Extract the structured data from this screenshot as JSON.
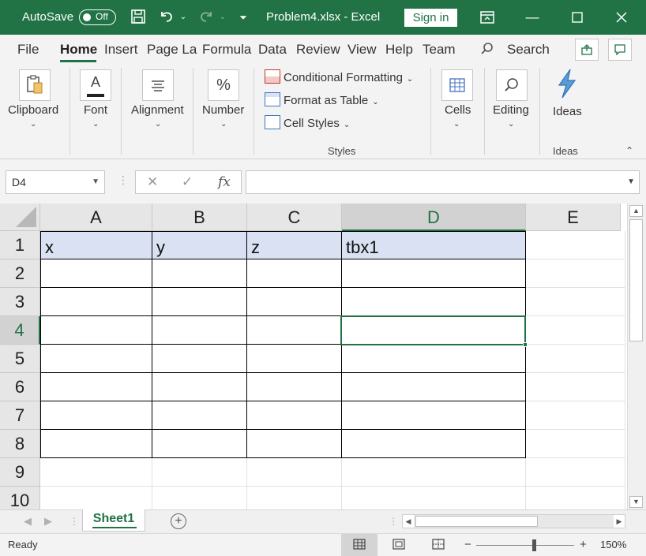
{
  "titlebar": {
    "autosave_label": "AutoSave",
    "autosave_state": "Off",
    "filename": "Problem4.xlsx",
    "separator": "-",
    "app_name": "Excel",
    "signin_label": "Sign in",
    "accent_color": "#217346"
  },
  "tabs": [
    "File",
    "Home",
    "Insert",
    "Page La",
    "Formula",
    "Data",
    "Review",
    "View",
    "Help",
    "Team"
  ],
  "active_tab": "Home",
  "search_label": "Search",
  "ribbon": {
    "clipboard": "Clipboard",
    "font": "Font",
    "alignment": "Alignment",
    "number": "Number",
    "conditional_formatting": "Conditional Formatting",
    "format_as_table": "Format as Table",
    "cell_styles": "Cell Styles",
    "styles_group": "Styles",
    "cells": "Cells",
    "editing": "Editing",
    "ideas": "Ideas",
    "ideas_group": "Ideas",
    "number_glyph": "%"
  },
  "formula_bar": {
    "name_box": "D4",
    "fx_label": "fx",
    "formula": ""
  },
  "grid": {
    "columns": [
      "A",
      "B",
      "C",
      "D",
      "E"
    ],
    "rows": [
      "1",
      "2",
      "3",
      "4",
      "5",
      "6",
      "7",
      "8",
      "9",
      "10"
    ],
    "selected_cell": "D4",
    "cells": {
      "A1": "x",
      "B1": "y",
      "C1": "z",
      "D1": "tbx1"
    },
    "header_fill_color": "#d9e1f2"
  },
  "sheets": [
    "Sheet1"
  ],
  "status": {
    "ready": "Ready",
    "zoom": "150%"
  }
}
